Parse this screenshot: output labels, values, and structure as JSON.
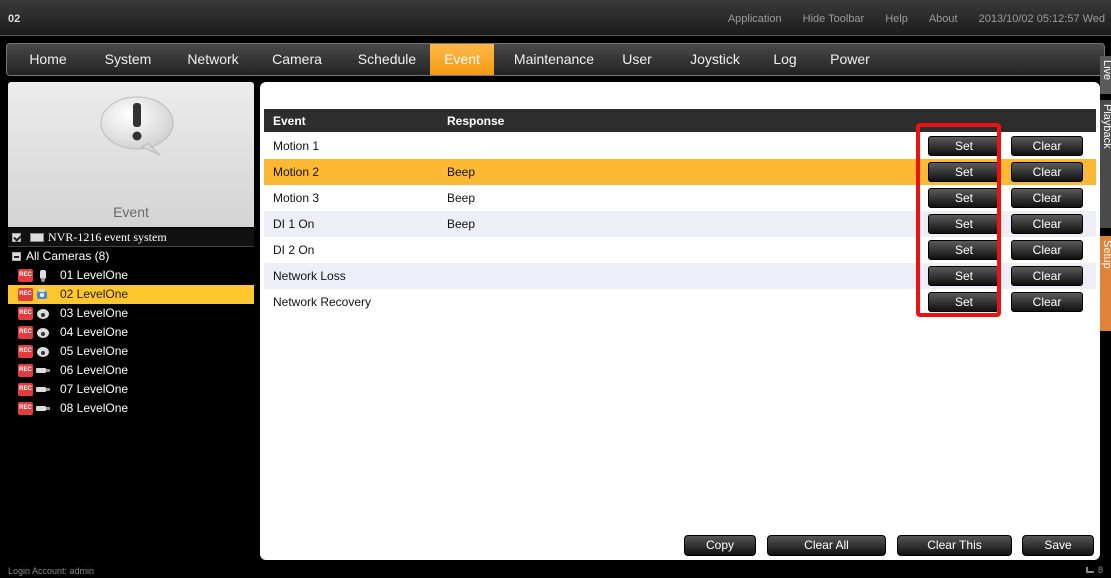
{
  "window": {
    "title": "02"
  },
  "top_menu": [
    "Application",
    "Hide Toolbar",
    "Help",
    "About",
    "2013/10/02 05:12:57 Wed"
  ],
  "nav": {
    "tabs": [
      "Home",
      "System",
      "Network",
      "Camera",
      "Schedule",
      "Event",
      "Maintenance",
      "User",
      "Joystick",
      "Log",
      "Power"
    ],
    "active": "Event"
  },
  "side_tabs": [
    "Live",
    "Playback",
    "Setup"
  ],
  "left_panel": {
    "icon": "exclamation-bubble-icon",
    "title": "Event",
    "root": "NVR-1216 event system",
    "group": "All Cameras (8)",
    "cameras": [
      {
        "label": "01  LevelOne",
        "icon": "bullet-camera-icon",
        "selected": false
      },
      {
        "label": "02  LevelOne",
        "icon": "ptz-camera-icon",
        "selected": true
      },
      {
        "label": "03  LevelOne",
        "icon": "dome-camera-icon",
        "selected": false
      },
      {
        "label": "04  LevelOne",
        "icon": "dome-camera-icon",
        "selected": false
      },
      {
        "label": "05  LevelOne",
        "icon": "dome-camera-icon",
        "selected": false
      },
      {
        "label": "06  LevelOne",
        "icon": "box-camera-icon",
        "selected": false
      },
      {
        "label": "07  LevelOne",
        "icon": "box-camera-icon",
        "selected": false
      },
      {
        "label": "08  LevelOne",
        "icon": "box-camera-icon",
        "selected": false
      }
    ],
    "rec_badge": "REC"
  },
  "table": {
    "headers": [
      "Event",
      "Response"
    ],
    "rows": [
      {
        "event": "Motion 1",
        "response": ""
      },
      {
        "event": "Motion 2",
        "response": "Beep"
      },
      {
        "event": "Motion 3",
        "response": "Beep"
      },
      {
        "event": "DI 1 On",
        "response": "Beep"
      },
      {
        "event": "DI 2 On",
        "response": ""
      },
      {
        "event": "Network Loss",
        "response": ""
      },
      {
        "event": "Network Recovery",
        "response": ""
      }
    ],
    "selected_index": 1,
    "set_label": "Set",
    "clear_label": "Clear"
  },
  "bottom_buttons": [
    "Copy",
    "Clear All",
    "Clear This",
    "Save"
  ],
  "status": {
    "login": "Login Account: admin",
    "right": "8"
  },
  "colors": {
    "accent": "#f5a623",
    "selected_row": "#fdb933",
    "highlight": "#ee1111"
  }
}
